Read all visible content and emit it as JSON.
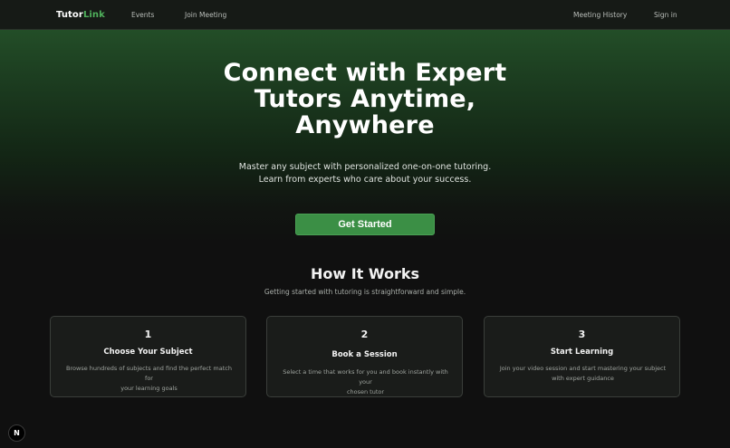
{
  "navbar": {
    "brand_part1": "Tutor",
    "brand_part2": "Link",
    "links": [
      "Events",
      "Join Meeting"
    ],
    "right_links": [
      "Meeting History",
      "Sign in"
    ]
  },
  "hero": {
    "title_line1": "Connect with Expert",
    "title_line2": "Tutors Anytime,",
    "title_line3": "Anywhere",
    "subtitle_line1": "Master any subject with personalized one-on-one tutoring.",
    "subtitle_line2": "Learn from experts who care about your success.",
    "cta_label": "Get Started"
  },
  "how": {
    "title": "How It Works",
    "subtitle": "Getting started with tutoring is straightforward and simple.",
    "steps": [
      {
        "number": "1",
        "title": "Choose Your Subject",
        "desc_line1": "Browse hundreds of subjects and find the perfect match for",
        "desc_line2": "your learning goals"
      },
      {
        "number": "2",
        "title": "Book a Session",
        "desc_line1": "Select a time that works for you and book instantly with your",
        "desc_line2": "chosen tutor"
      },
      {
        "number": "3",
        "title": "Start Learning",
        "desc_line1": "Join your video session and start mastering your subject",
        "desc_line2": "with expert guidance"
      }
    ]
  },
  "badge": {
    "letter": "N",
    "icon": "nextjs-logo-icon"
  },
  "colors": {
    "accent": "#3b8f45",
    "brand_green": "#4fb05b",
    "background": "#101010"
  }
}
